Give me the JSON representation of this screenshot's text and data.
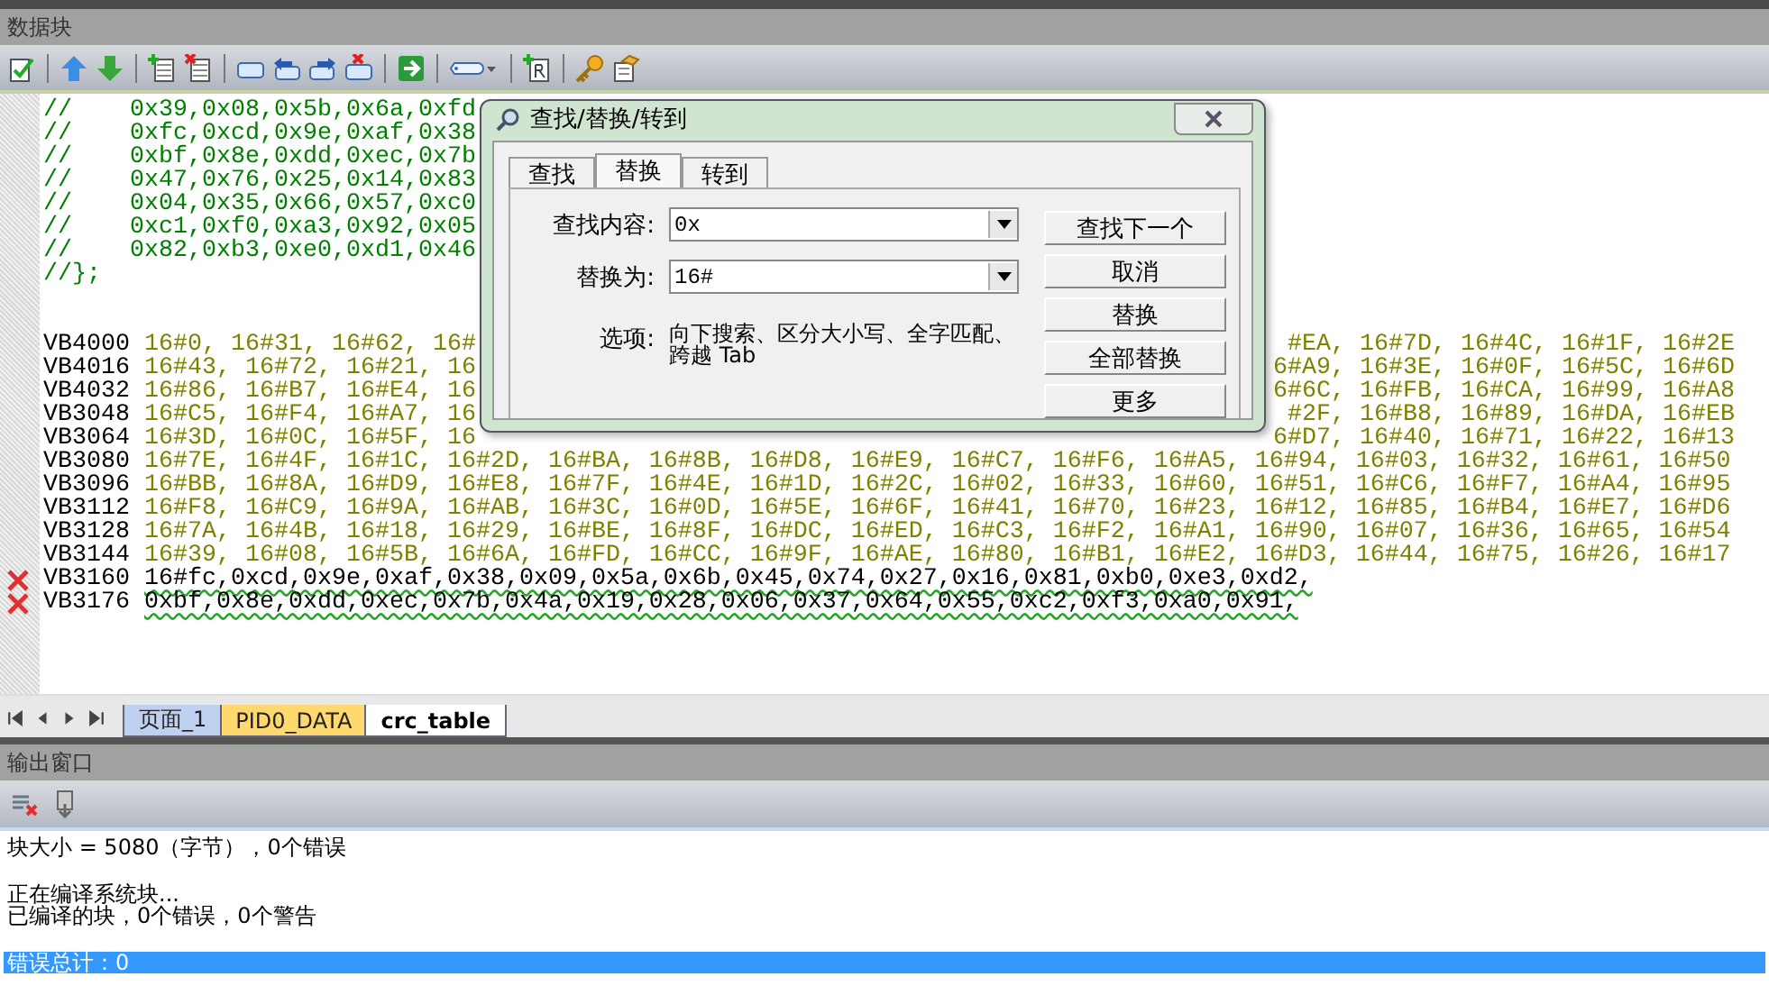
{
  "panel_title": "数据块",
  "editor_lines": [
    {
      "kind": "comment",
      "text": "//    0x39,0x08,0x5b,0x6a,0xfd"
    },
    {
      "kind": "comment",
      "text": "//    0xfc,0xcd,0x9e,0xaf,0x38"
    },
    {
      "kind": "comment",
      "text": "//    0xbf,0x8e,0xdd,0xec,0x7b"
    },
    {
      "kind": "comment",
      "text": "//    0x47,0x76,0x25,0x14,0x83"
    },
    {
      "kind": "comment",
      "text": "//    0x04,0x35,0x66,0x57,0xc0"
    },
    {
      "kind": "comment",
      "text": "//    0xc1,0xf0,0xa3,0x92,0x05"
    },
    {
      "kind": "comment",
      "text": "//    0x82,0xb3,0xe0,0xd1,0x46"
    },
    {
      "kind": "comment",
      "text": "//};"
    },
    {
      "kind": "data",
      "label": "VB4000",
      "text": "16#0, 16#31, 16#62, 16#",
      "text_right": "#EA, 16#7D, 16#4C, 16#1F, 16#2E"
    },
    {
      "kind": "data",
      "label": "VB4016",
      "text": "16#43, 16#72, 16#21, 16",
      "text_right": "6#A9, 16#3E, 16#0F, 16#5C, 16#6D"
    },
    {
      "kind": "data",
      "label": "VB4032",
      "text": "16#86, 16#B7, 16#E4, 16",
      "text_right": "6#6C, 16#FB, 16#CA, 16#99, 16#A8"
    },
    {
      "kind": "data",
      "label": "VB3048",
      "text": "16#C5, 16#F4, 16#A7, 16",
      "text_right": "#2F, 16#B8, 16#89, 16#DA, 16#EB"
    },
    {
      "kind": "data",
      "label": "VB3064",
      "text": "16#3D, 16#0C, 16#5F, 16",
      "text_right": "6#D7, 16#40, 16#71, 16#22, 16#13"
    },
    {
      "kind": "data",
      "label": "VB3080",
      "text": "16#7E, 16#4F, 16#1C, 16#2D, 16#BA, 16#8B, 16#D8, 16#E9, 16#C7, 16#F6, 16#A5, 16#94, 16#03, 16#32, 16#61, 16#50"
    },
    {
      "kind": "data",
      "label": "VB3096",
      "text": "16#BB, 16#8A, 16#D9, 16#E8, 16#7F, 16#4E, 16#1D, 16#2C, 16#02, 16#33, 16#60, 16#51, 16#C6, 16#F7, 16#A4, 16#95"
    },
    {
      "kind": "data",
      "label": "VB3112",
      "text": "16#F8, 16#C9, 16#9A, 16#AB, 16#3C, 16#0D, 16#5E, 16#6F, 16#41, 16#70, 16#23, 16#12, 16#85, 16#B4, 16#E7, 16#D6"
    },
    {
      "kind": "data",
      "label": "VB3128",
      "text": "16#7A, 16#4B, 16#18, 16#29, 16#BE, 16#8F, 16#DC, 16#ED, 16#C3, 16#F2, 16#A1, 16#90, 16#07, 16#36, 16#65, 16#54"
    },
    {
      "kind": "data",
      "label": "VB3144",
      "text": "16#39, 16#08, 16#5B, 16#6A, 16#FD, 16#CC, 16#9F, 16#AE, 16#80, 16#B1, 16#E2, 16#D3, 16#44, 16#75, 16#26, 16#17"
    },
    {
      "kind": "error",
      "label": "VB3160",
      "text": "16#fc,0xcd,0x9e,0xaf,0x38,0x09,0x5a,0x6b,0x45,0x74,0x27,0x16,0x81,0xb0,0xe3,0xd2,"
    },
    {
      "kind": "error",
      "label": "VB3176",
      "text": "0xbf,0x8e,0xdd,0xec,0x7b,0x4a,0x19,0x28,0x06,0x37,0x64,0x55,0xc2,0xf3,0xa0,0x91,"
    }
  ],
  "dialog": {
    "title": "查找/替换/转到",
    "tabs": [
      {
        "label": "查找",
        "selected": false
      },
      {
        "label": "替换",
        "selected": true
      },
      {
        "label": "转到",
        "selected": false
      }
    ],
    "find_label": "查找内容:",
    "find_value": "0x",
    "replace_label": "替换为:",
    "replace_value": "16#",
    "options_label": "选项:",
    "options_text": "向下搜索、区分大小写、全字匹配、跨越 Tab",
    "buttons": [
      "查找下一个",
      "取消",
      "替换",
      "全部替换",
      "更多"
    ]
  },
  "sheet_tabs": [
    {
      "label": "页面_1",
      "color": "#c0d0f0",
      "selected": false
    },
    {
      "label": "PID0_DATA",
      "color": "#ffd870",
      "selected": false
    },
    {
      "label": "crc_table",
      "color": "#ffffff",
      "selected": true
    }
  ],
  "output": {
    "title": "输出窗口",
    "groups": [
      [
        {
          "text": "块大小 = 5080（字节），0个错误",
          "selected": false
        }
      ],
      [
        {
          "text": "正在编译系统块...",
          "selected": false
        },
        {
          "text": "已编译的块，0个错误，0个警告",
          "selected": false
        }
      ],
      [
        {
          "text": "错误总计：0",
          "selected": true
        }
      ]
    ]
  }
}
